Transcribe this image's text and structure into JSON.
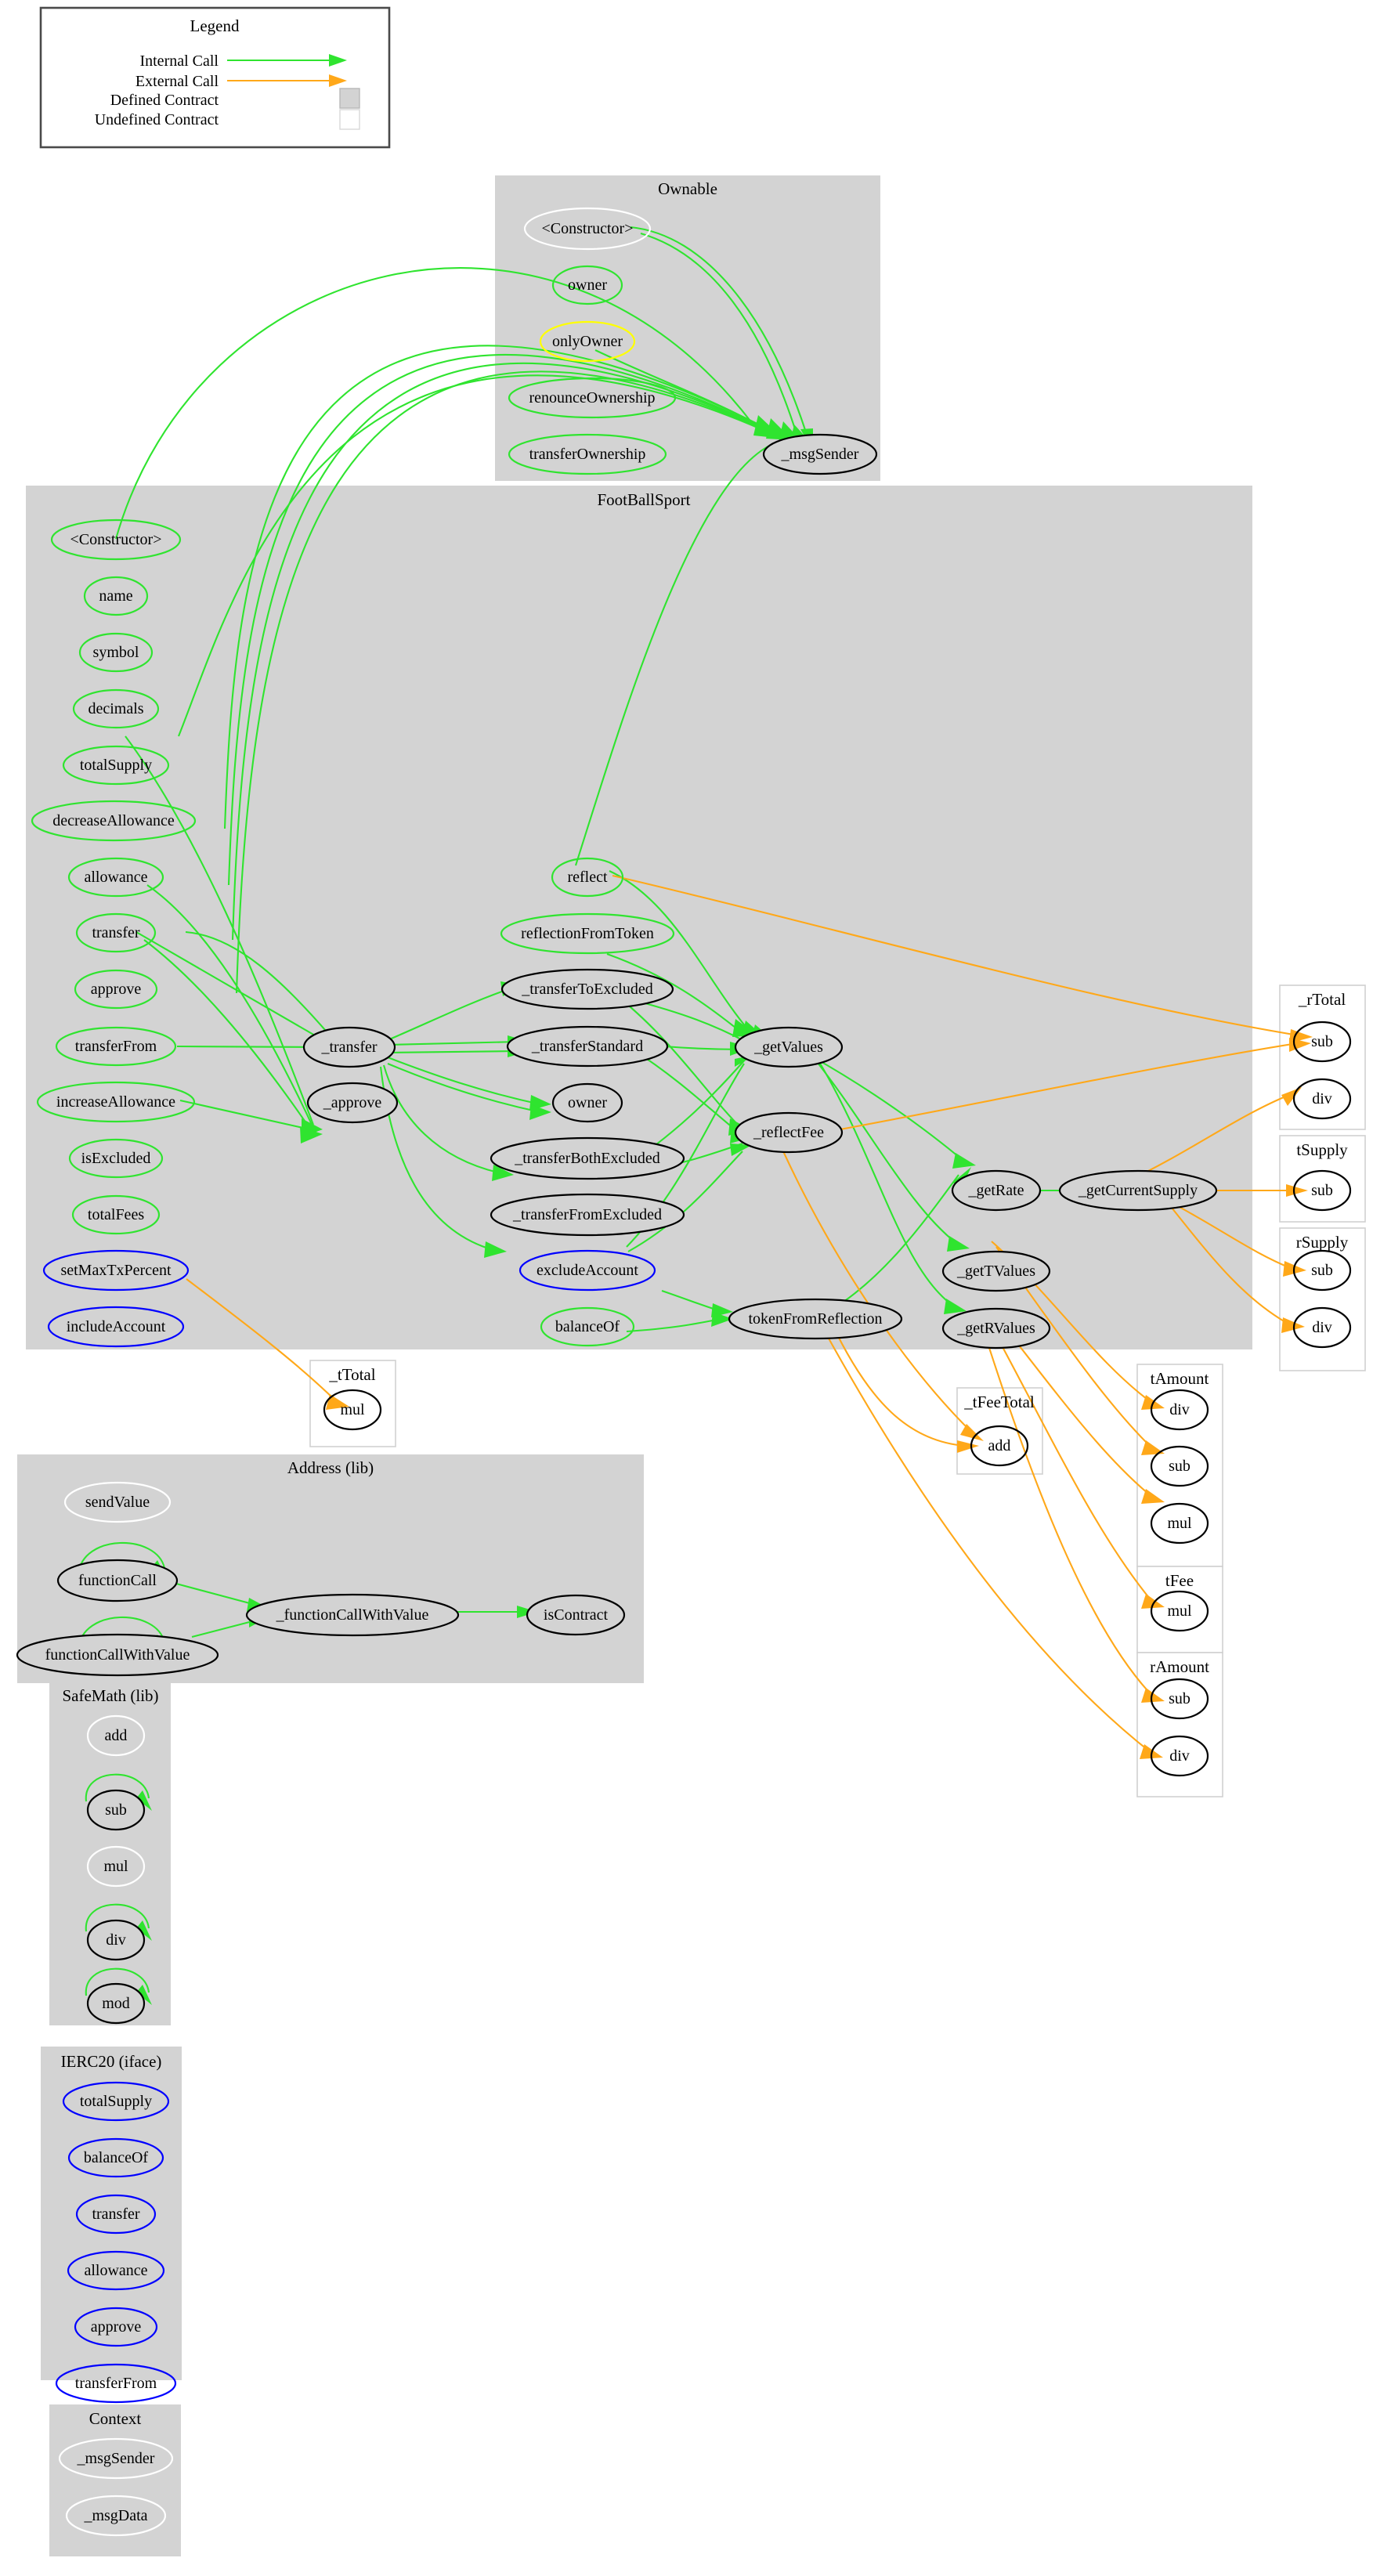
{
  "legend": {
    "title": "Legend",
    "rows": [
      {
        "label": "Internal Call",
        "kind": "line",
        "color": "#2fe42f"
      },
      {
        "label": "External Call",
        "kind": "line",
        "color": "#ffa819"
      },
      {
        "label": "Defined Contract",
        "kind": "swatch",
        "color": "#d3d3d3"
      },
      {
        "label": "Undefined Contract",
        "kind": "swatch",
        "color": "#ffffff"
      }
    ]
  },
  "colors": {
    "internal_call": "#2fe42f",
    "external_call": "#ffa819",
    "defined_contract": "#d3d3d3",
    "undefined_contract": "#ffffff",
    "node_public": "#2fe42f",
    "node_internal": "#000000",
    "node_external": "#0000ff",
    "node_modifier": "#ffff00",
    "node_undefined": "#ffffff"
  },
  "clusters": [
    {
      "id": "ownable",
      "title": "Ownable",
      "style": "filled",
      "nodes": [
        {
          "id": "ow_ctor",
          "label": "<Constructor>",
          "outline": "white"
        },
        {
          "id": "ow_owner",
          "label": "owner",
          "outline": "green"
        },
        {
          "id": "ow_onlyOwner",
          "label": "onlyOwner",
          "outline": "yellow"
        },
        {
          "id": "ow_renounce",
          "label": "renounceOwnership",
          "outline": "green"
        },
        {
          "id": "ow_transferOwnership",
          "label": "transferOwnership",
          "outline": "green"
        },
        {
          "id": "ow_msgSender",
          "label": "_msgSender",
          "outline": "black"
        }
      ]
    },
    {
      "id": "footballsport",
      "title": "FootBallSport",
      "style": "filled",
      "nodes": [
        {
          "id": "fb_ctor",
          "label": "<Constructor>",
          "outline": "green"
        },
        {
          "id": "fb_name",
          "label": "name",
          "outline": "green"
        },
        {
          "id": "fb_symbol",
          "label": "symbol",
          "outline": "green"
        },
        {
          "id": "fb_decimals",
          "label": "decimals",
          "outline": "green"
        },
        {
          "id": "fb_totalSupply",
          "label": "totalSupply",
          "outline": "green"
        },
        {
          "id": "fb_decreaseAllowance",
          "label": "decreaseAllowance",
          "outline": "green"
        },
        {
          "id": "fb_allowance",
          "label": "allowance",
          "outline": "green"
        },
        {
          "id": "fb_transfer",
          "label": "transfer",
          "outline": "green"
        },
        {
          "id": "fb_approve",
          "label": "approve",
          "outline": "green"
        },
        {
          "id": "fb_transferFrom",
          "label": "transferFrom",
          "outline": "green"
        },
        {
          "id": "fb_increaseAllowance",
          "label": "increaseAllowance",
          "outline": "green"
        },
        {
          "id": "fb_isExcluded",
          "label": "isExcluded",
          "outline": "green"
        },
        {
          "id": "fb_totalFees",
          "label": "totalFees",
          "outline": "green"
        },
        {
          "id": "fb_setMaxTxPercent",
          "label": "setMaxTxPercent",
          "outline": "blue"
        },
        {
          "id": "fb_includeAccount",
          "label": "includeAccount",
          "outline": "blue"
        },
        {
          "id": "fb__transfer",
          "label": "_transfer",
          "outline": "black"
        },
        {
          "id": "fb__approve",
          "label": "_approve",
          "outline": "black"
        },
        {
          "id": "fb_reflect",
          "label": "reflect",
          "outline": "green"
        },
        {
          "id": "fb_reflectionFromToken",
          "label": "reflectionFromToken",
          "outline": "green"
        },
        {
          "id": "fb__transferToExcluded",
          "label": "_transferToExcluded",
          "outline": "black"
        },
        {
          "id": "fb__transferStandard",
          "label": "_transferStandard",
          "outline": "black"
        },
        {
          "id": "fb_owner",
          "label": "owner",
          "outline": "black"
        },
        {
          "id": "fb__transferBothExcluded",
          "label": "_transferBothExcluded",
          "outline": "black"
        },
        {
          "id": "fb__transferFromExcluded",
          "label": "_transferFromExcluded",
          "outline": "black"
        },
        {
          "id": "fb_excludeAccount",
          "label": "excludeAccount",
          "outline": "blue"
        },
        {
          "id": "fb_balanceOf",
          "label": "balanceOf",
          "outline": "green"
        },
        {
          "id": "fb__getValues",
          "label": "_getValues",
          "outline": "black"
        },
        {
          "id": "fb__reflectFee",
          "label": "_reflectFee",
          "outline": "black"
        },
        {
          "id": "fb_tokenFromReflection",
          "label": "tokenFromReflection",
          "outline": "black"
        },
        {
          "id": "fb__getRate",
          "label": "_getRate",
          "outline": "black"
        },
        {
          "id": "fb__getTValues",
          "label": "_getTValues",
          "outline": "black"
        },
        {
          "id": "fb__getRValues",
          "label": "_getRValues",
          "outline": "black"
        },
        {
          "id": "fb__getCurrentSupply",
          "label": "_getCurrentSupply",
          "outline": "black"
        }
      ]
    },
    {
      "id": "address_lib",
      "title": "Address  (lib)",
      "style": "filled",
      "nodes": [
        {
          "id": "ad_sendValue",
          "label": "sendValue",
          "outline": "white"
        },
        {
          "id": "ad_functionCall",
          "label": "functionCall",
          "outline": "black"
        },
        {
          "id": "ad_functionCallWithValue",
          "label": "functionCallWithValue",
          "outline": "black"
        },
        {
          "id": "ad__functionCallWithValue",
          "label": "_functionCallWithValue",
          "outline": "black"
        },
        {
          "id": "ad_isContract",
          "label": "isContract",
          "outline": "black"
        }
      ]
    },
    {
      "id": "safemath_lib",
      "title": "SafeMath  (lib)",
      "style": "filled",
      "nodes": [
        {
          "id": "sm_add",
          "label": "add",
          "outline": "white"
        },
        {
          "id": "sm_sub",
          "label": "sub",
          "outline": "black"
        },
        {
          "id": "sm_mul",
          "label": "mul",
          "outline": "white"
        },
        {
          "id": "sm_div",
          "label": "div",
          "outline": "black"
        },
        {
          "id": "sm_mod",
          "label": "mod",
          "outline": "black"
        }
      ]
    },
    {
      "id": "ierc20_iface",
      "title": "IERC20  (iface)",
      "style": "filled",
      "nodes": [
        {
          "id": "ie_totalSupply",
          "label": "totalSupply",
          "outline": "blue"
        },
        {
          "id": "ie_balanceOf",
          "label": "balanceOf",
          "outline": "blue"
        },
        {
          "id": "ie_transfer",
          "label": "transfer",
          "outline": "blue"
        },
        {
          "id": "ie_allowance",
          "label": "allowance",
          "outline": "blue"
        },
        {
          "id": "ie_approve",
          "label": "approve",
          "outline": "blue"
        },
        {
          "id": "ie_transferFrom",
          "label": "transferFrom",
          "outline": "blue"
        }
      ]
    },
    {
      "id": "context",
      "title": "Context",
      "style": "filled",
      "nodes": [
        {
          "id": "cx__msgSender",
          "label": "_msgSender",
          "outline": "white"
        },
        {
          "id": "cx__msgData",
          "label": "_msgData",
          "outline": "white"
        }
      ]
    },
    {
      "id": "rtotal",
      "title": "_rTotal",
      "style": "undefined",
      "nodes": [
        {
          "id": "rt_sub",
          "label": "sub",
          "outline": "black"
        },
        {
          "id": "rt_div",
          "label": "div",
          "outline": "black"
        }
      ]
    },
    {
      "id": "tsupply",
      "title": "tSupply",
      "style": "undefined",
      "nodes": [
        {
          "id": "ts_sub",
          "label": "sub",
          "outline": "black"
        }
      ]
    },
    {
      "id": "rsupply",
      "title": "rSupply",
      "style": "undefined",
      "nodes": [
        {
          "id": "rs_sub",
          "label": "sub",
          "outline": "black"
        },
        {
          "id": "rs_div",
          "label": "div",
          "outline": "black"
        }
      ]
    },
    {
      "id": "ttotal",
      "title": "_tTotal",
      "style": "undefined",
      "nodes": [
        {
          "id": "tt_mul",
          "label": "mul",
          "outline": "black"
        }
      ]
    },
    {
      "id": "tfeetotal",
      "title": "_tFeeTotal",
      "style": "undefined",
      "nodes": [
        {
          "id": "tft_add",
          "label": "add",
          "outline": "black"
        }
      ]
    },
    {
      "id": "tamount",
      "title": "tAmount",
      "style": "undefined",
      "nodes": [
        {
          "id": "ta_div",
          "label": "div",
          "outline": "black"
        },
        {
          "id": "ta_sub",
          "label": "sub",
          "outline": "black"
        },
        {
          "id": "ta_mul",
          "label": "mul",
          "outline": "black"
        }
      ]
    },
    {
      "id": "tfee",
      "title": "tFee",
      "style": "undefined",
      "nodes": [
        {
          "id": "tf_mul",
          "label": "mul",
          "outline": "black"
        }
      ]
    },
    {
      "id": "ramount",
      "title": "rAmount",
      "style": "undefined",
      "nodes": [
        {
          "id": "ra_sub",
          "label": "sub",
          "outline": "black"
        },
        {
          "id": "ra_div",
          "label": "div",
          "outline": "black"
        }
      ]
    }
  ],
  "edges": [
    {
      "from": "ow_ctor",
      "to": "ow_msgSender",
      "type": "internal"
    },
    {
      "from": "ow_ctor",
      "to": "ow_msgSender",
      "type": "internal"
    },
    {
      "from": "ow_onlyOwner",
      "to": "ow_msgSender",
      "type": "internal"
    },
    {
      "from": "fb_ctor",
      "to": "ow_msgSender",
      "type": "internal"
    },
    {
      "from": "fb_transfer",
      "to": "ow_msgSender",
      "type": "internal"
    },
    {
      "from": "fb_approve",
      "to": "ow_msgSender",
      "type": "internal"
    },
    {
      "from": "fb_transferFrom",
      "to": "ow_msgSender",
      "type": "internal"
    },
    {
      "from": "fb_increaseAllowance",
      "to": "ow_msgSender",
      "type": "internal"
    },
    {
      "from": "fb_decreaseAllowance",
      "to": "ow_msgSender",
      "type": "internal"
    },
    {
      "from": "fb_reflect",
      "to": "ow_msgSender",
      "type": "internal"
    },
    {
      "from": "fb_transfer",
      "to": "fb__transfer",
      "type": "internal"
    },
    {
      "from": "fb_transferFrom",
      "to": "fb__transfer",
      "type": "internal"
    },
    {
      "from": "fb_approve",
      "to": "fb__approve",
      "type": "internal"
    },
    {
      "from": "fb_transferFrom",
      "to": "fb__approve",
      "type": "internal"
    },
    {
      "from": "fb_increaseAllowance",
      "to": "fb__approve",
      "type": "internal"
    },
    {
      "from": "fb_decreaseAllowance",
      "to": "fb__approve",
      "type": "internal"
    },
    {
      "from": "fb__transfer",
      "to": "fb__transferToExcluded",
      "type": "internal"
    },
    {
      "from": "fb__transfer",
      "to": "fb__transferStandard",
      "type": "internal"
    },
    {
      "from": "fb__transfer",
      "to": "fb_owner",
      "type": "internal"
    },
    {
      "from": "fb__transfer",
      "to": "fb__transferBothExcluded",
      "type": "internal"
    },
    {
      "from": "fb__transfer",
      "to": "fb__transferFromExcluded",
      "type": "internal"
    },
    {
      "from": "fb_reflect",
      "to": "fb__getValues",
      "type": "internal"
    },
    {
      "from": "fb_reflectionFromToken",
      "to": "fb__getValues",
      "type": "internal"
    },
    {
      "from": "fb__transferToExcluded",
      "to": "fb__getValues",
      "type": "internal"
    },
    {
      "from": "fb__transferStandard",
      "to": "fb__getValues",
      "type": "internal"
    },
    {
      "from": "fb__transferBothExcluded",
      "to": "fb__getValues",
      "type": "internal"
    },
    {
      "from": "fb__transferFromExcluded",
      "to": "fb__getValues",
      "type": "internal"
    },
    {
      "from": "fb__transferToExcluded",
      "to": "fb__reflectFee",
      "type": "internal"
    },
    {
      "from": "fb__transferStandard",
      "to": "fb__reflectFee",
      "type": "internal"
    },
    {
      "from": "fb__transferBothExcluded",
      "to": "fb__reflectFee",
      "type": "internal"
    },
    {
      "from": "fb__transferFromExcluded",
      "to": "fb__reflectFee",
      "type": "internal"
    },
    {
      "from": "fb_excludeAccount",
      "to": "fb_tokenFromReflection",
      "type": "internal"
    },
    {
      "from": "fb_balanceOf",
      "to": "fb_tokenFromReflection",
      "type": "internal"
    },
    {
      "from": "fb__getValues",
      "to": "fb__getRate",
      "type": "internal"
    },
    {
      "from": "fb__getValues",
      "to": "fb__getTValues",
      "type": "internal"
    },
    {
      "from": "fb__getValues",
      "to": "fb__getRValues",
      "type": "internal"
    },
    {
      "from": "fb_tokenFromReflection",
      "to": "fb__getRate",
      "type": "internal"
    },
    {
      "from": "fb__getRate",
      "to": "fb__getCurrentSupply",
      "type": "internal"
    },
    {
      "from": "fb_reflect",
      "to": "rt_sub",
      "type": "external"
    },
    {
      "from": "fb__reflectFee",
      "to": "rt_sub",
      "type": "external"
    },
    {
      "from": "fb__getCurrentSupply",
      "to": "rt_div",
      "type": "external"
    },
    {
      "from": "fb__getCurrentSupply",
      "to": "ts_sub",
      "type": "external"
    },
    {
      "from": "fb__getCurrentSupply",
      "to": "rs_sub",
      "type": "external"
    },
    {
      "from": "fb__getCurrentSupply",
      "to": "rs_div",
      "type": "external"
    },
    {
      "from": "fb_setMaxTxPercent",
      "to": "tt_mul",
      "type": "external"
    },
    {
      "from": "fb__reflectFee",
      "to": "tft_add",
      "type": "external"
    },
    {
      "from": "fb_tokenFromReflection",
      "to": "tft_add",
      "type": "external"
    },
    {
      "from": "fb__getTValues",
      "to": "ta_div",
      "type": "external"
    },
    {
      "from": "fb__getTValues",
      "to": "ta_sub",
      "type": "external"
    },
    {
      "from": "fb__getRValues",
      "to": "ta_mul",
      "type": "external"
    },
    {
      "from": "fb__getRValues",
      "to": "tf_mul",
      "type": "external"
    },
    {
      "from": "fb__getRValues",
      "to": "ra_sub",
      "type": "external"
    },
    {
      "from": "fb_tokenFromReflection",
      "to": "ra_div",
      "type": "external"
    },
    {
      "from": "ad_functionCall",
      "to": "ad_functionCall",
      "type": "internal"
    },
    {
      "from": "ad_functionCallWithValue",
      "to": "ad_functionCallWithValue",
      "type": "internal"
    },
    {
      "from": "ad_functionCall",
      "to": "ad__functionCallWithValue",
      "type": "internal"
    },
    {
      "from": "ad_functionCallWithValue",
      "to": "ad__functionCallWithValue",
      "type": "internal"
    },
    {
      "from": "ad__functionCallWithValue",
      "to": "ad_isContract",
      "type": "internal"
    },
    {
      "from": "sm_sub",
      "to": "sm_sub",
      "type": "internal"
    },
    {
      "from": "sm_div",
      "to": "sm_div",
      "type": "internal"
    },
    {
      "from": "sm_mod",
      "to": "sm_mod",
      "type": "internal"
    }
  ]
}
